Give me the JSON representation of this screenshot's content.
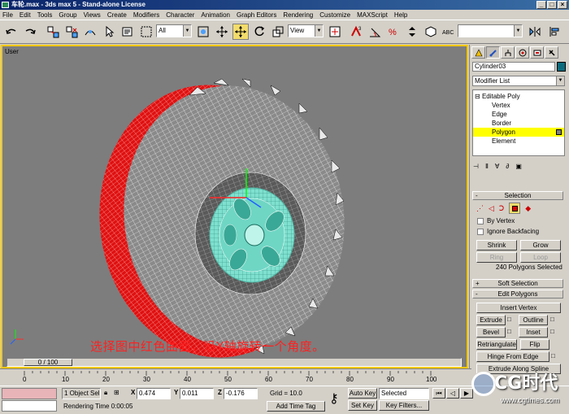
{
  "window": {
    "title": "车轮.max - 3ds max 5 - Stand-alone License",
    "buttons": [
      "_",
      "□",
      "×"
    ]
  },
  "menu": [
    "File",
    "Edit",
    "Tools",
    "Group",
    "Views",
    "Create",
    "Modifiers",
    "Character",
    "Animation",
    "Graph Editors",
    "Rendering",
    "Customize",
    "MAXScript",
    "Help"
  ],
  "toolbar": {
    "selection_filter": "All",
    "reference_coord": "View",
    "named_selection": ""
  },
  "viewport": {
    "label": "User",
    "caption": "选择图中红色曲面，沿Y轴旋转一个角度。"
  },
  "command_panel": {
    "object_name": "Cylinder03",
    "object_color": "#0b6c7d",
    "modifier_list": "Modifier List",
    "stack": {
      "root": "Editable Poly",
      "items": [
        "Vertex",
        "Edge",
        "Border",
        "Polygon",
        "Element"
      ],
      "selected": "Polygon"
    },
    "selection": {
      "title": "Selection",
      "by_vertex": "By Vertex",
      "ignore_backfacing": "Ignore Backfacing",
      "shrink": "Shrink",
      "grow": "Grow",
      "ring": "Ring",
      "loop": "Loop",
      "status": "240 Polygons Selected"
    },
    "soft_selection": "Soft Selection",
    "edit_polygons": {
      "title": "Edit Polygons",
      "insert_vertex": "Insert Vertex",
      "extrude": "Extrude",
      "outline": "Outline",
      "bevel": "Bevel",
      "inset": "Inset",
      "retriangulate": "Retriangulate",
      "flip": "Flip",
      "hinge_from_edge": "Hinge From Edge",
      "extrude_along_spline": "Extrude Along Spline"
    }
  },
  "timeline": {
    "slider": "0 / 100",
    "ticks": [
      "0",
      "10",
      "20",
      "30",
      "40",
      "50",
      "60",
      "70",
      "80",
      "90",
      "100"
    ]
  },
  "status": {
    "selection_count": "1 Object Sele",
    "x_label": "X",
    "x": "0.474",
    "y_label": "Y",
    "y": "0.011",
    "z_label": "Z",
    "z": "-0.176",
    "grid": "Grid = 10.0",
    "rendering_time": "Rendering Time  0:00:05",
    "add_time_tag": "Add Time Tag",
    "auto_key": "Auto Key",
    "set_key": "Set Key",
    "key_mode": "Selected",
    "key_filters": "Key Filters..."
  },
  "watermark": {
    "title": "CG时代",
    "url": "www.cgtimes.com"
  },
  "colors": {
    "title_bar": "#0a246a",
    "viewport_bg": "#7d7d7d",
    "active_viewport_border": "#f5c800",
    "selected_polygons": "#e01010",
    "wireframe": "#ffffff",
    "hub": "#6fd6c4",
    "caption": "#ff2020"
  }
}
